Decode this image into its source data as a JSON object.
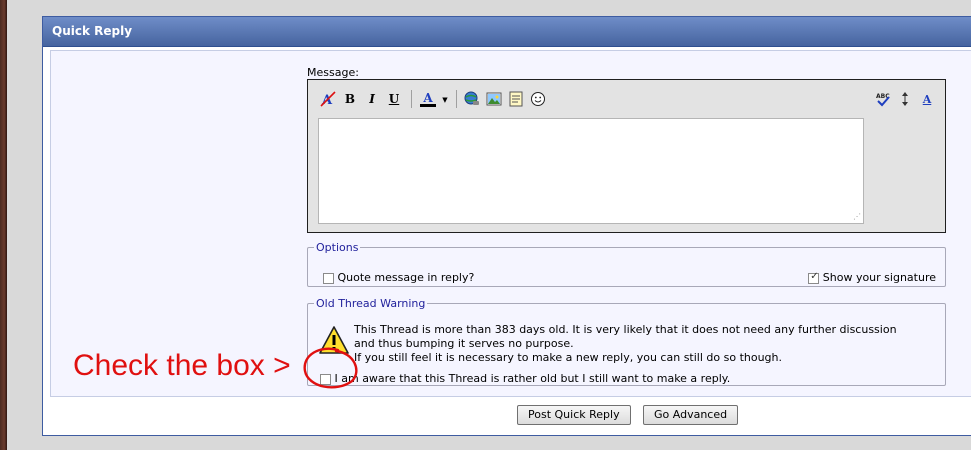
{
  "panel": {
    "title": "Quick Reply"
  },
  "editor": {
    "label": "Message:",
    "text": "",
    "tools": {
      "bold": "B",
      "italic": "I",
      "underline": "U",
      "font_color": "A",
      "resize": "A"
    }
  },
  "options": {
    "legend": "Options",
    "quote_label": "Quote message in reply?",
    "quote_checked": false,
    "signature_label": "Show your signature",
    "signature_checked": true
  },
  "warning": {
    "legend": "Old Thread Warning",
    "line1": "This Thread is more than 383 days old. It is very likely that it does not need any further discussion",
    "line2": "and thus bumping it serves no purpose.",
    "line3": "If you still feel it is necessary to make a new reply, you can still do so though.",
    "confirm_label": "I am aware that this Thread is rather old but I still want to make a reply.",
    "confirm_checked": false
  },
  "buttons": {
    "post": "Post Quick Reply",
    "advanced": "Go Advanced"
  },
  "annotation": {
    "text": "Check the box >"
  },
  "colors": {
    "header": "#46649f",
    "legend": "#22229c",
    "annotation": "#e01010"
  }
}
